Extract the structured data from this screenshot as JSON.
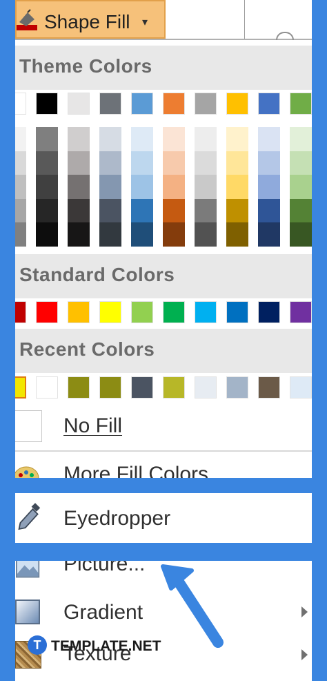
{
  "toolbar": {
    "shape_fill_label": "Shape Fill",
    "caret": "▾"
  },
  "theme_colors": {
    "header": "Theme Colors",
    "top_row": [
      "#ffffff",
      "#000000",
      "#e7e6e6",
      "#6d7278",
      "#5b9bd5",
      "#ed7d31",
      "#a5a5a5",
      "#ffc000",
      "#4472c4",
      "#70ad47"
    ],
    "shades": [
      [
        "#f2f2f2",
        "#d9d9d9",
        "#bfbfbf",
        "#a6a6a6",
        "#808080"
      ],
      [
        "#7f7f7f",
        "#595959",
        "#404040",
        "#262626",
        "#0d0d0d"
      ],
      [
        "#d0cece",
        "#aeaaaa",
        "#757171",
        "#3b3838",
        "#171616"
      ],
      [
        "#d6dce4",
        "#adb9ca",
        "#8497b0",
        "#4b5462",
        "#32393f"
      ],
      [
        "#deeaf6",
        "#bdd7ee",
        "#9dc3e6",
        "#2e75b6",
        "#1f4e79"
      ],
      [
        "#fbe4d5",
        "#f7caac",
        "#f4b183",
        "#c55a11",
        "#843c0c"
      ],
      [
        "#ededed",
        "#dbdbdb",
        "#c9c9c9",
        "#7b7b7b",
        "#525252"
      ],
      [
        "#fff2cc",
        "#ffe699",
        "#ffd966",
        "#bf9000",
        "#7f6000"
      ],
      [
        "#dae3f3",
        "#b4c7e7",
        "#8faadc",
        "#2f5597",
        "#203864"
      ],
      [
        "#e2f0d9",
        "#c5e0b4",
        "#a9d18e",
        "#548235",
        "#385723"
      ]
    ]
  },
  "standard_colors": {
    "header": "Standard Colors",
    "colors": [
      "#c00000",
      "#ff0000",
      "#ffc000",
      "#ffff00",
      "#92d050",
      "#00b050",
      "#00b0f0",
      "#0070c0",
      "#002060",
      "#7030a0"
    ]
  },
  "recent_colors": {
    "header": "Recent Colors",
    "colors": [
      "#f2e600",
      "#ffffff",
      "#8c8c14",
      "#8c8c14",
      "#4b5462",
      "#b7b728",
      "#e7ecf2",
      "#a3b4c8",
      "#6b5a48",
      "#deeaf6"
    ]
  },
  "menu": {
    "no_fill": "No Fill",
    "more_fill_colors": "More Fill Colors...",
    "eyedropper": "Eyedropper",
    "picture": "Picture...",
    "gradient": "Gradient",
    "texture": "Texture"
  },
  "watermark": {
    "logo_letter": "T",
    "text": "TEMPLATE.NET"
  },
  "colors": {
    "frame_blue": "#3a85e0",
    "header_grey": "#e8e8e8",
    "hover_orange": "#f6c17a"
  }
}
